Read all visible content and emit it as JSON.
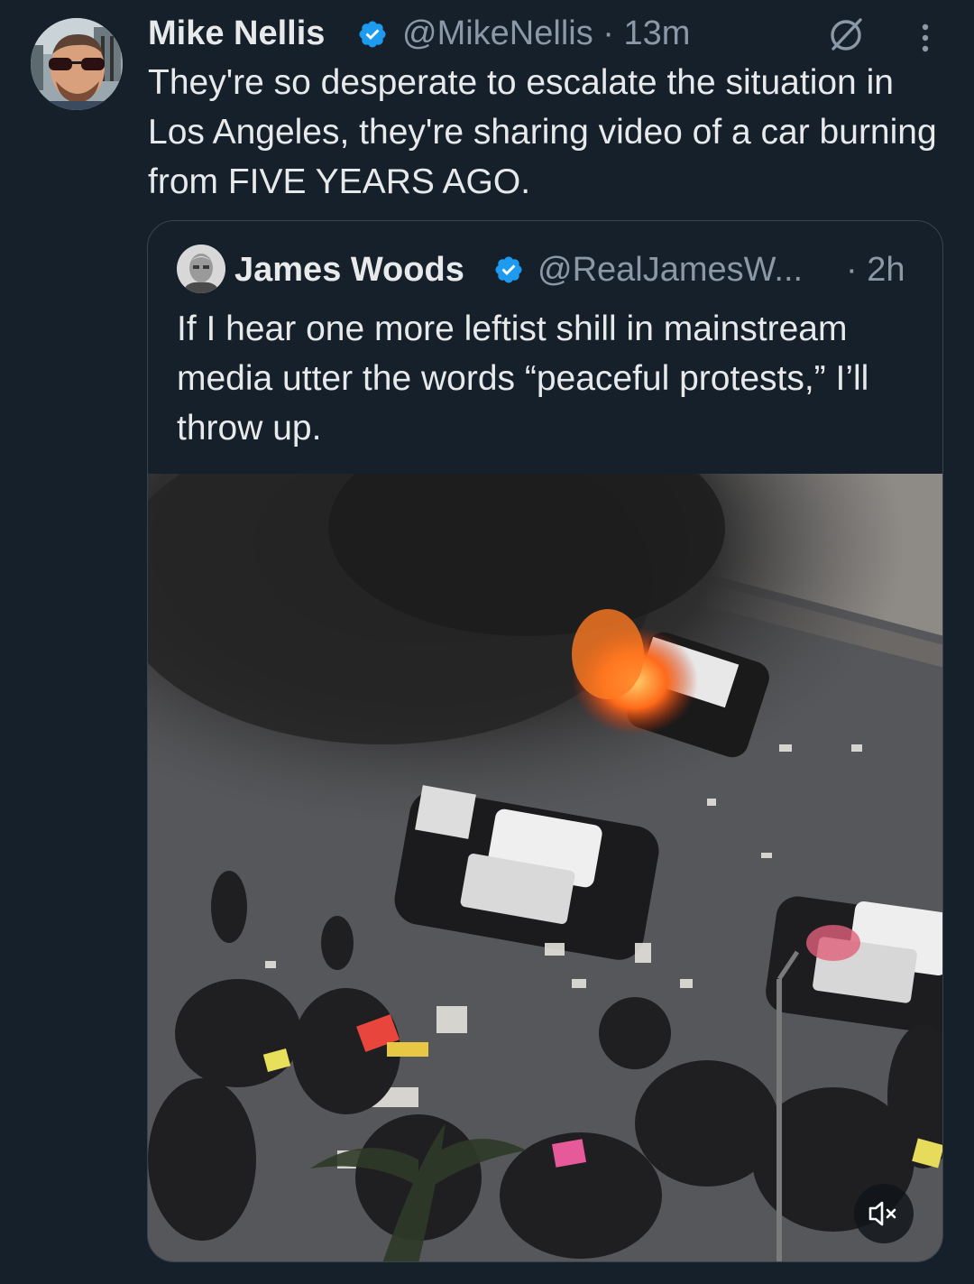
{
  "tweet": {
    "author_name": "Mike Nellis",
    "handle_time": "@MikeNellis · 13m",
    "text": "They're so desperate to escalate the situation in Los Angeles, they're sharing video of a car burning from FIVE YEARS AGO.",
    "icons": [
      "verified-badge-icon",
      "grok-icon",
      "more-options-icon"
    ]
  },
  "quote": {
    "author_name": "James Woods",
    "handle": "@RealJamesW...",
    "time": "· 2h",
    "text": "If I hear one more leftist shill in mainstream media utter the words “peaceful protests,” I’ll throw up.",
    "media": {
      "type": "video",
      "icons": [
        "muted-speaker-icon"
      ]
    }
  },
  "colors": {
    "background": "#15202b",
    "text": "#e7e9ea",
    "secondary_text": "#8b98a5",
    "verified_blue": "#1d9bf0",
    "card_border": "#38444d"
  }
}
